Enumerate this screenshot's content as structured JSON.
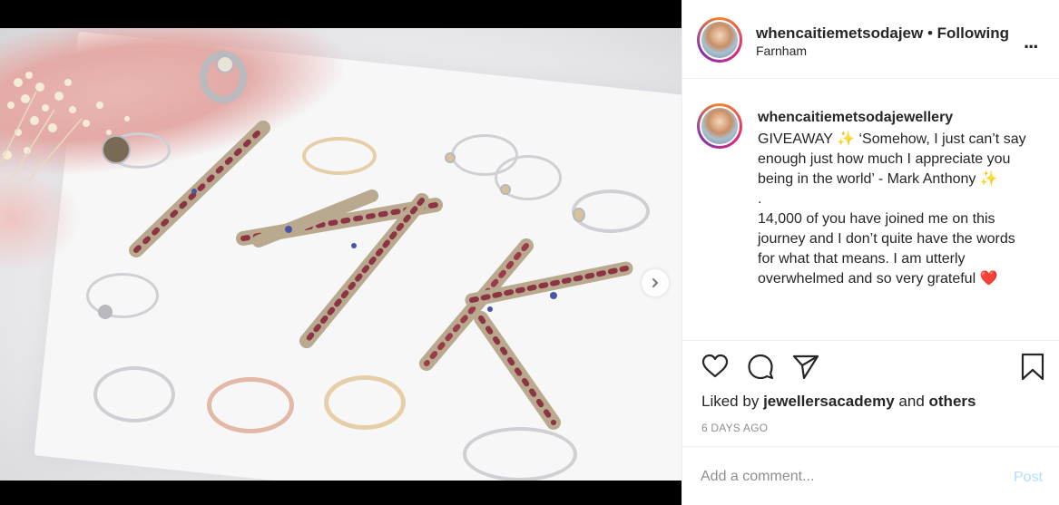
{
  "header": {
    "username": "whencaitiemetsodajew",
    "separator": "•",
    "follow_status": "Following",
    "location": "Farnham",
    "more_label": "..."
  },
  "caption": {
    "username": "whencaitiemetsodajewellery",
    "text": "GIVEAWAY ✨ ‘Somehow, I just can’t say enough just how much I appreciate you being in the world’ - Mark Anthony ✨\n.\n14,000 of you have joined me on this journey and I don’t quite have the words for what that means. I am utterly overwhelmed and so very grateful ❤️"
  },
  "actions": {
    "like_icon": "heart-icon",
    "comment_icon": "comment-icon",
    "share_icon": "send-icon",
    "save_icon": "bookmark-icon"
  },
  "likes": {
    "prefix": "Liked by",
    "user": "jewellersacademy",
    "joiner": "and",
    "others": "others"
  },
  "date": "6 DAYS AGO",
  "comment": {
    "placeholder": "Add a comment...",
    "post_label": "Post"
  },
  "carousel": {
    "current_index": 1,
    "total": 2
  },
  "colors": {
    "text": "#262626",
    "secondary": "#8e8e8e",
    "post_disabled": "#b2dffc",
    "border": "#efefef"
  }
}
